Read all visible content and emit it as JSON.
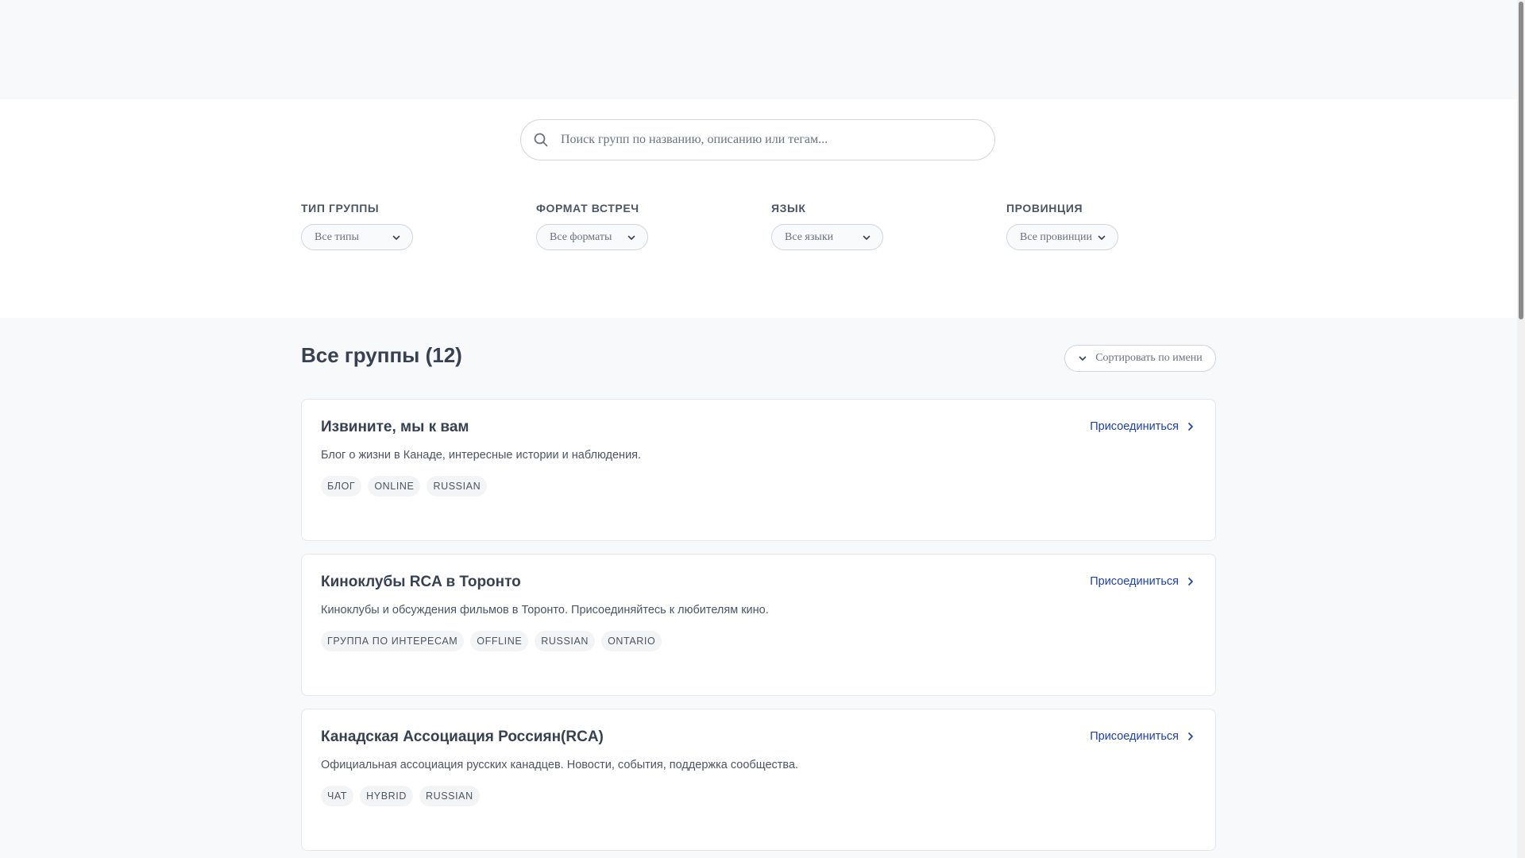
{
  "search": {
    "placeholder": "Поиск групп по названию, описанию или тегам..."
  },
  "filters": [
    {
      "label": "ТИП ГРУППЫ",
      "value": "Все типы"
    },
    {
      "label": "ФОРМАТ ВСТРЕЧ",
      "value": "Все форматы"
    },
    {
      "label": "ЯЗЫК",
      "value": "Все языки"
    },
    {
      "label": "ПРОВИНЦИЯ",
      "value": "Все провинции"
    }
  ],
  "results": {
    "title": "Все группы (12)",
    "sort_label": "Сортировать по имени"
  },
  "groups": [
    {
      "title": "Извините, мы к вам",
      "description": "Блог о жизни в Канаде, интересные истории и наблюдения.",
      "tags": [
        "БЛОГ",
        "ONLINE",
        "RUSSIAN"
      ],
      "action": "Присоединиться"
    },
    {
      "title": "Киноклубы RCA в Торонто",
      "description": "Киноклубы и обсуждения фильмов в Торонто. Присоединяйтесь к любителям кино.",
      "tags": [
        "ГРУППА ПО ИНТЕРЕСАМ",
        "OFFLINE",
        "RUSSIAN",
        "ONTARIO"
      ],
      "action": "Присоединиться"
    },
    {
      "title": "Канадская Ассоциация Россиян(RCA)",
      "description": "Официальная ассоциация русских канадцев. Новости, события, поддержка сообщества.",
      "tags": [
        "ЧАТ",
        "HYBRID",
        "RUSSIAN"
      ],
      "action": "Присоединиться"
    }
  ],
  "colors": {
    "accent": "#1e40af",
    "page_background": "#f8f9fa",
    "card_background": "#ffffff"
  },
  "icons": {
    "search": "search-icon",
    "dropdown": "chevron-down-icon",
    "join": "chevron-right-icon"
  }
}
